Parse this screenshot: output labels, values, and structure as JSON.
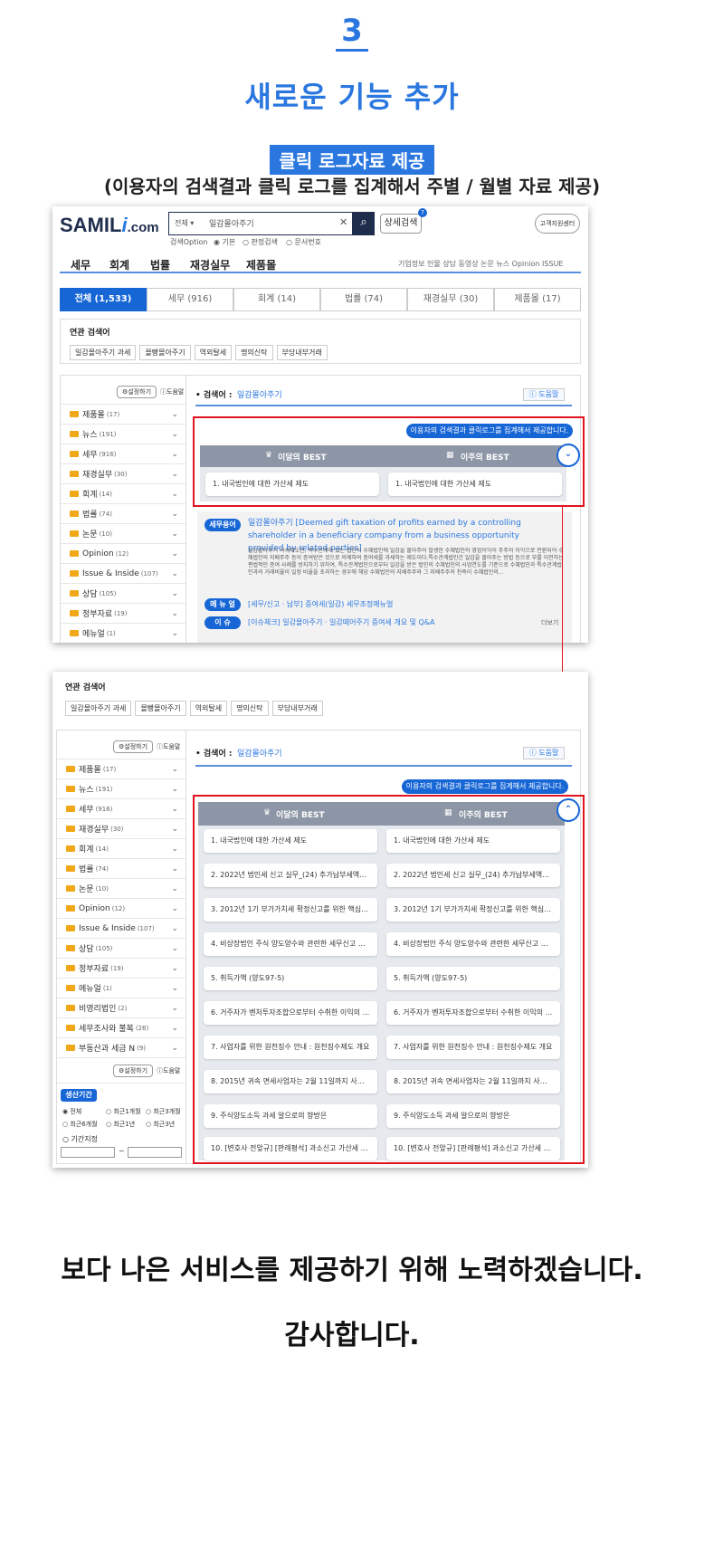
{
  "header": {
    "step_number": "3",
    "title": "새로운 기능 추가",
    "badge": "클릭 로그자료 제공",
    "subtitle": "(이용자의 검색결과 클릭 로그를 집계해서 주별 / 월별 자료 제공)"
  },
  "site": {
    "logo_main": "SAMIL",
    "logo_i": "i",
    "logo_suffix": ".com",
    "search_scope": "전체 ▾",
    "search_value": "일감몰아주기",
    "clear": "✕",
    "detail_search": "상세검색",
    "customer_center": "고객지원센터",
    "search_option_label": "검색Option",
    "options": [
      "◉ 기본",
      "○ 판정검색",
      "○ 문서번호"
    ],
    "nav": [
      "세무",
      "회계",
      "법률",
      "재경실무",
      "제품몰"
    ],
    "nav_right": "기업정보  인물  상담  동영상  논문  뉴스  Opinion  ISSUE"
  },
  "tabs": [
    "전체 (1,533)",
    "세무 (916)",
    "회계 (14)",
    "법률 (74)",
    "재경실무 (30)",
    "제품몰 (17)"
  ],
  "related": {
    "label": "연관 검색어",
    "keywords": [
      "일감몰아주기 과세",
      "몰빵몰아주기",
      "역외탈세",
      "명의신탁",
      "부당내부거래"
    ]
  },
  "sidebar": {
    "settings": "설정하기",
    "help": "도움말",
    "items": [
      {
        "name": "제품몰",
        "count": "(17)"
      },
      {
        "name": "뉴스",
        "count": "(191)"
      },
      {
        "name": "세무",
        "count": "(916)"
      },
      {
        "name": "재경실무",
        "count": "(30)"
      },
      {
        "name": "회계",
        "count": "(14)"
      },
      {
        "name": "법률",
        "count": "(74)"
      },
      {
        "name": "논문",
        "count": "(10)"
      },
      {
        "name": "Opinion",
        "count": "(12)"
      },
      {
        "name": "Issue & Inside",
        "count": "(107)"
      },
      {
        "name": "상담",
        "count": "(105)"
      },
      {
        "name": "정부자료",
        "count": "(19)"
      },
      {
        "name": "메뉴얼",
        "count": "(1)"
      },
      {
        "name": "비영리법인",
        "count": "(2)"
      },
      {
        "name": "세무조사와 불복",
        "count": "(26)"
      },
      {
        "name": "부동산과 세금 N",
        "count": "(9)"
      }
    ],
    "period_title": "생산기간",
    "period_options": [
      "◉ 전체",
      "○ 최근1개월",
      "○ 최근3개월",
      "○ 최근6개월",
      "○ 최근1년",
      "○ 최근3년"
    ],
    "custom_period": "○ 기간지정",
    "date_sep": "~"
  },
  "result": {
    "keyword_label": "• 검색어 :",
    "keyword": "일감몰아주기",
    "help": "ⓘ 도움말",
    "notice": "이용자의 검색결과 클릭로그를 집계해서 제공합니다.",
    "month_best": "이달의 BEST",
    "week_best": "이주의 BEST",
    "toggle_down": "⌄",
    "toggle_up": "⌃",
    "items": [
      "1. 내국법인에 대한 가산세 제도",
      "2. 2022년 법인세 신고 실무_(24) 추가납부세액과 ...",
      "3. 2012년 1기 부가가치세 확정신고를 위한 핵심 P...",
      "4. 비상장법인 주식 양도양수와 관련한 세무신고 및...",
      "5. 취득가액 (양도97-5)",
      "6. 거주자가 벤처투자조합으로부터 수취한 이익의 ...",
      "7. 사업자를 위한 원천징수 안내 : 원천징수제도 개요",
      "8. 2015년 귀속 면세사업자는 2월 11일까지 사업장...",
      "9. 주식양도소득 과세 알으로의 향방은",
      "10. [변호사 전앞규] [판례평석] 과소신고 가산세 부..."
    ],
    "glossary_tag": "세무용어",
    "glossary_title": "일감몰아주기 [Deemed gift taxation of profits earned by a controlling shareholder in a beneficiary company from a business opportunity provided by related parties]",
    "glossary_body": "일감몰아주기 과세제도란, 특수관계에 있는 법인이 수혜법인에 일감을 몰아주어 발생한 수혜법인의 영업이익이 주주의 이익으로 전환되어 수혜법인의 지배주주 등이 증여받은 것으로 의제하여 증여세를 과세하는 제도이다.특수관계법인간 일감을 몰아주는 방법 등으로 부를 이전하는 편법적인 증여 사례를 방지하기 위하여, 특수관계법인으로부터 일감을 받은 법인의 수혜법인의 사업연도를 기준으로 수혜법인과 특수관계법인과의 거래비율이 일정 비율을 초과하는 경우에 해당 수혜법인의 지배주주와 그 지배주주의 친족이 수혜법인의...",
    "menu_tag": "메 뉴 얼",
    "menu_text": "[세무/신고 · 납부] 증여세(일감) 세무조정매뉴얼",
    "issue_tag": "이  슈",
    "issue_text": "[이슈체크] 일감몰아주기 · 일감떼어주기 증여세 개요 및 Q&A",
    "more": "더보기"
  },
  "footer": {
    "line1": "보다 나은 서비스를 제공하기 위해 노력하겠습니다.",
    "line2": "감사합니다."
  }
}
